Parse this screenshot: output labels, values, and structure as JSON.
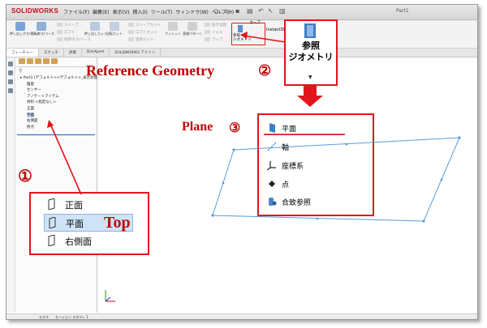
{
  "app": {
    "logo_text": "SOLIDWORKS",
    "window_title": "Part1",
    "menu": [
      "ファイル(F)",
      "編集(E)",
      "表示(V)",
      "挿入(I)",
      "ツール(T)",
      "ウィンドウ(W)",
      "ヘルプ(H)"
    ]
  },
  "command_bar": {
    "items": [
      {
        "label": "押し出しボス/ベース",
        "color": "#7aa4d6"
      },
      {
        "label": "回転ボス/ベース",
        "color": "#8fb0d8"
      }
    ],
    "small_commands": [
      "スイープ",
      "ロフト",
      "境界ボス/ベース",
      "押し出しカット",
      "回転カット",
      "スイープカット",
      "ロフトカット",
      "境界カット",
      "フィレット",
      "直線パターン",
      "抜き勾配",
      "シェル",
      "ラップ",
      "交差",
      "ミラー"
    ],
    "reference_small": {
      "line1": "参照",
      "line2": "ジオメトリ"
    },
    "curves": {
      "line1": "カーブ",
      "line2": ""
    },
    "instant3d": "Instant3D"
  },
  "command_tabs": [
    "フィーチャー",
    "スケッチ",
    "評価",
    "DimXpert",
    "SOLIDWORKS アドイン"
  ],
  "feature_tree": {
    "items": [
      {
        "label": "Part1 (デフォルト<<デフォルト>_表示状態 1>)",
        "indent": 0
      },
      {
        "label": "履歴",
        "indent": 1
      },
      {
        "label": "センサー",
        "indent": 1
      },
      {
        "label": "アノテートアイテム",
        "indent": 1
      },
      {
        "label": "材料 <指定なし>",
        "indent": 1
      },
      {
        "label": "正面",
        "indent": 1
      },
      {
        "label": "平面",
        "indent": 1,
        "selected": true
      },
      {
        "label": "右側面",
        "indent": 1
      },
      {
        "label": "原点",
        "indent": 1
      }
    ]
  },
  "bottom_tabs": [
    "モデル",
    "モーション スタディ 1"
  ],
  "callouts": {
    "reference_geometry": "Reference Geometry",
    "reference_number": "②",
    "plane": "Plane",
    "plane_number": "③",
    "one_number": "①",
    "top": "Top"
  },
  "reference_button": {
    "line1": "参照",
    "line2": "ジオメトリ",
    "caret": "▼"
  },
  "dropdown": {
    "items": [
      {
        "label": "平面",
        "icon": "plane-icon"
      },
      {
        "label": "軸",
        "icon": "axis-icon"
      },
      {
        "label": "座標系",
        "icon": "coordinate-system-icon"
      },
      {
        "label": "点",
        "icon": "point-icon"
      },
      {
        "label": "合致参照",
        "icon": "mate-reference-icon"
      }
    ]
  },
  "planes_box": {
    "items": [
      {
        "label": "正面",
        "selected": false
      },
      {
        "label": "平面",
        "selected": true
      },
      {
        "label": "右側面",
        "selected": false
      }
    ]
  },
  "colors": {
    "accent_red": "#e0161a",
    "callout_text": "#c00000",
    "selection_blue": "#cfe3f7",
    "plane_blue": "#5b9bd5"
  }
}
